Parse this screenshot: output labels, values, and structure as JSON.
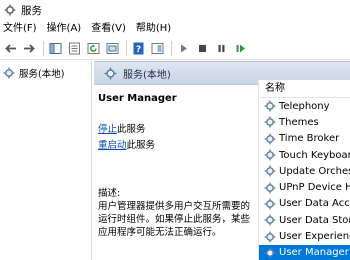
{
  "window": {
    "title": "服务"
  },
  "menu": [
    "文件(F)",
    "操作(A)",
    "查看(V)",
    "帮助(H)"
  ],
  "toolbar": {
    "icons": [
      "back-arrow-icon",
      "forward-arrow-icon",
      "console-tree-icon",
      "properties-icon",
      "refresh-icon",
      "export-icon",
      "help-icon",
      "view-icon",
      "play-icon",
      "stop-icon",
      "pause-icon",
      "restart-icon"
    ]
  },
  "tree": {
    "label": "服务(本地)"
  },
  "panel": {
    "title": "服务(本地)",
    "service_name": "User Manager",
    "stop_link": "停止",
    "stop_suffix": "此服务",
    "restart_link": "重启动",
    "restart_suffix": "此服务",
    "description_label": "描述:",
    "description_text": "用户管理器提供多用户交互所需要的运行时组件。如果停止此服务，某些应用程序可能无法正确运行。"
  },
  "list": {
    "header": "名称",
    "items": [
      "Telephony",
      "Themes",
      "Time Broker",
      "Touch Keyboard",
      "Update Orchestr",
      "UPnP Device Ho",
      "User Data Acces",
      "User Data Stora",
      "User Experience",
      "User Manager"
    ],
    "selected_index": 9
  },
  "colors": {
    "accent": "#0078d7",
    "link": "#0a4fb3",
    "header_gradient": "#c9d6e6"
  }
}
